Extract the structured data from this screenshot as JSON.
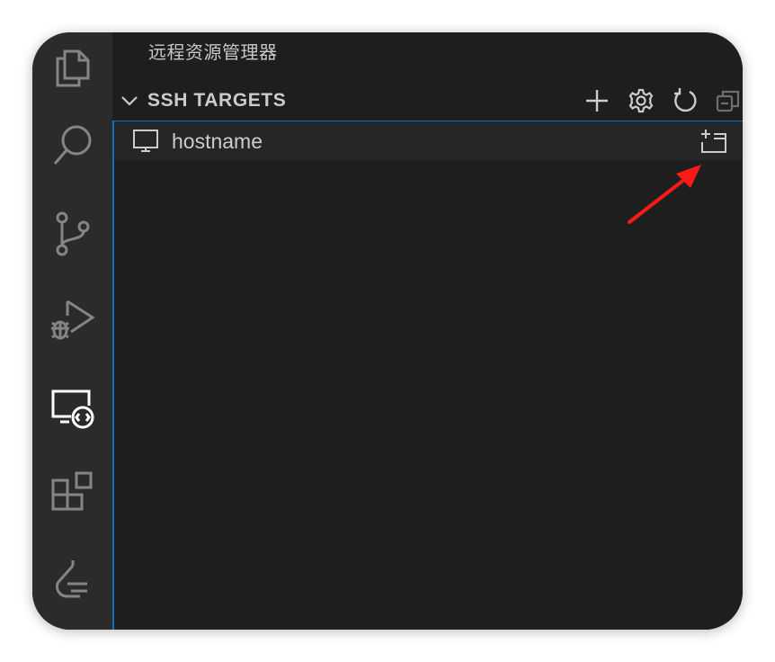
{
  "explorer": {
    "title": "远程资源管理器"
  },
  "section": {
    "title": "SSH TARGETS",
    "actions": [
      {
        "name": "add-icon"
      },
      {
        "name": "gear-icon"
      },
      {
        "name": "refresh-icon"
      },
      {
        "name": "collapse-all-icon"
      }
    ]
  },
  "targets": [
    {
      "label": "hostname",
      "icon": "monitor-icon",
      "action_icon": "open-in-new-window-icon"
    }
  ],
  "activity_bar": [
    {
      "name": "explorer-files-icon"
    },
    {
      "name": "search-icon"
    },
    {
      "name": "source-control-icon"
    },
    {
      "name": "run-debug-icon"
    },
    {
      "name": "remote-explorer-icon",
      "active": true
    },
    {
      "name": "extensions-icon"
    },
    {
      "name": "testing-icon"
    }
  ],
  "colors": {
    "activity_bar_bg": "#2b2b2b",
    "sidebar_bg": "#1e1e1e",
    "focus_border": "#0e70c0",
    "text": "#cccccc",
    "annotation_arrow": "#ff1a1a"
  }
}
